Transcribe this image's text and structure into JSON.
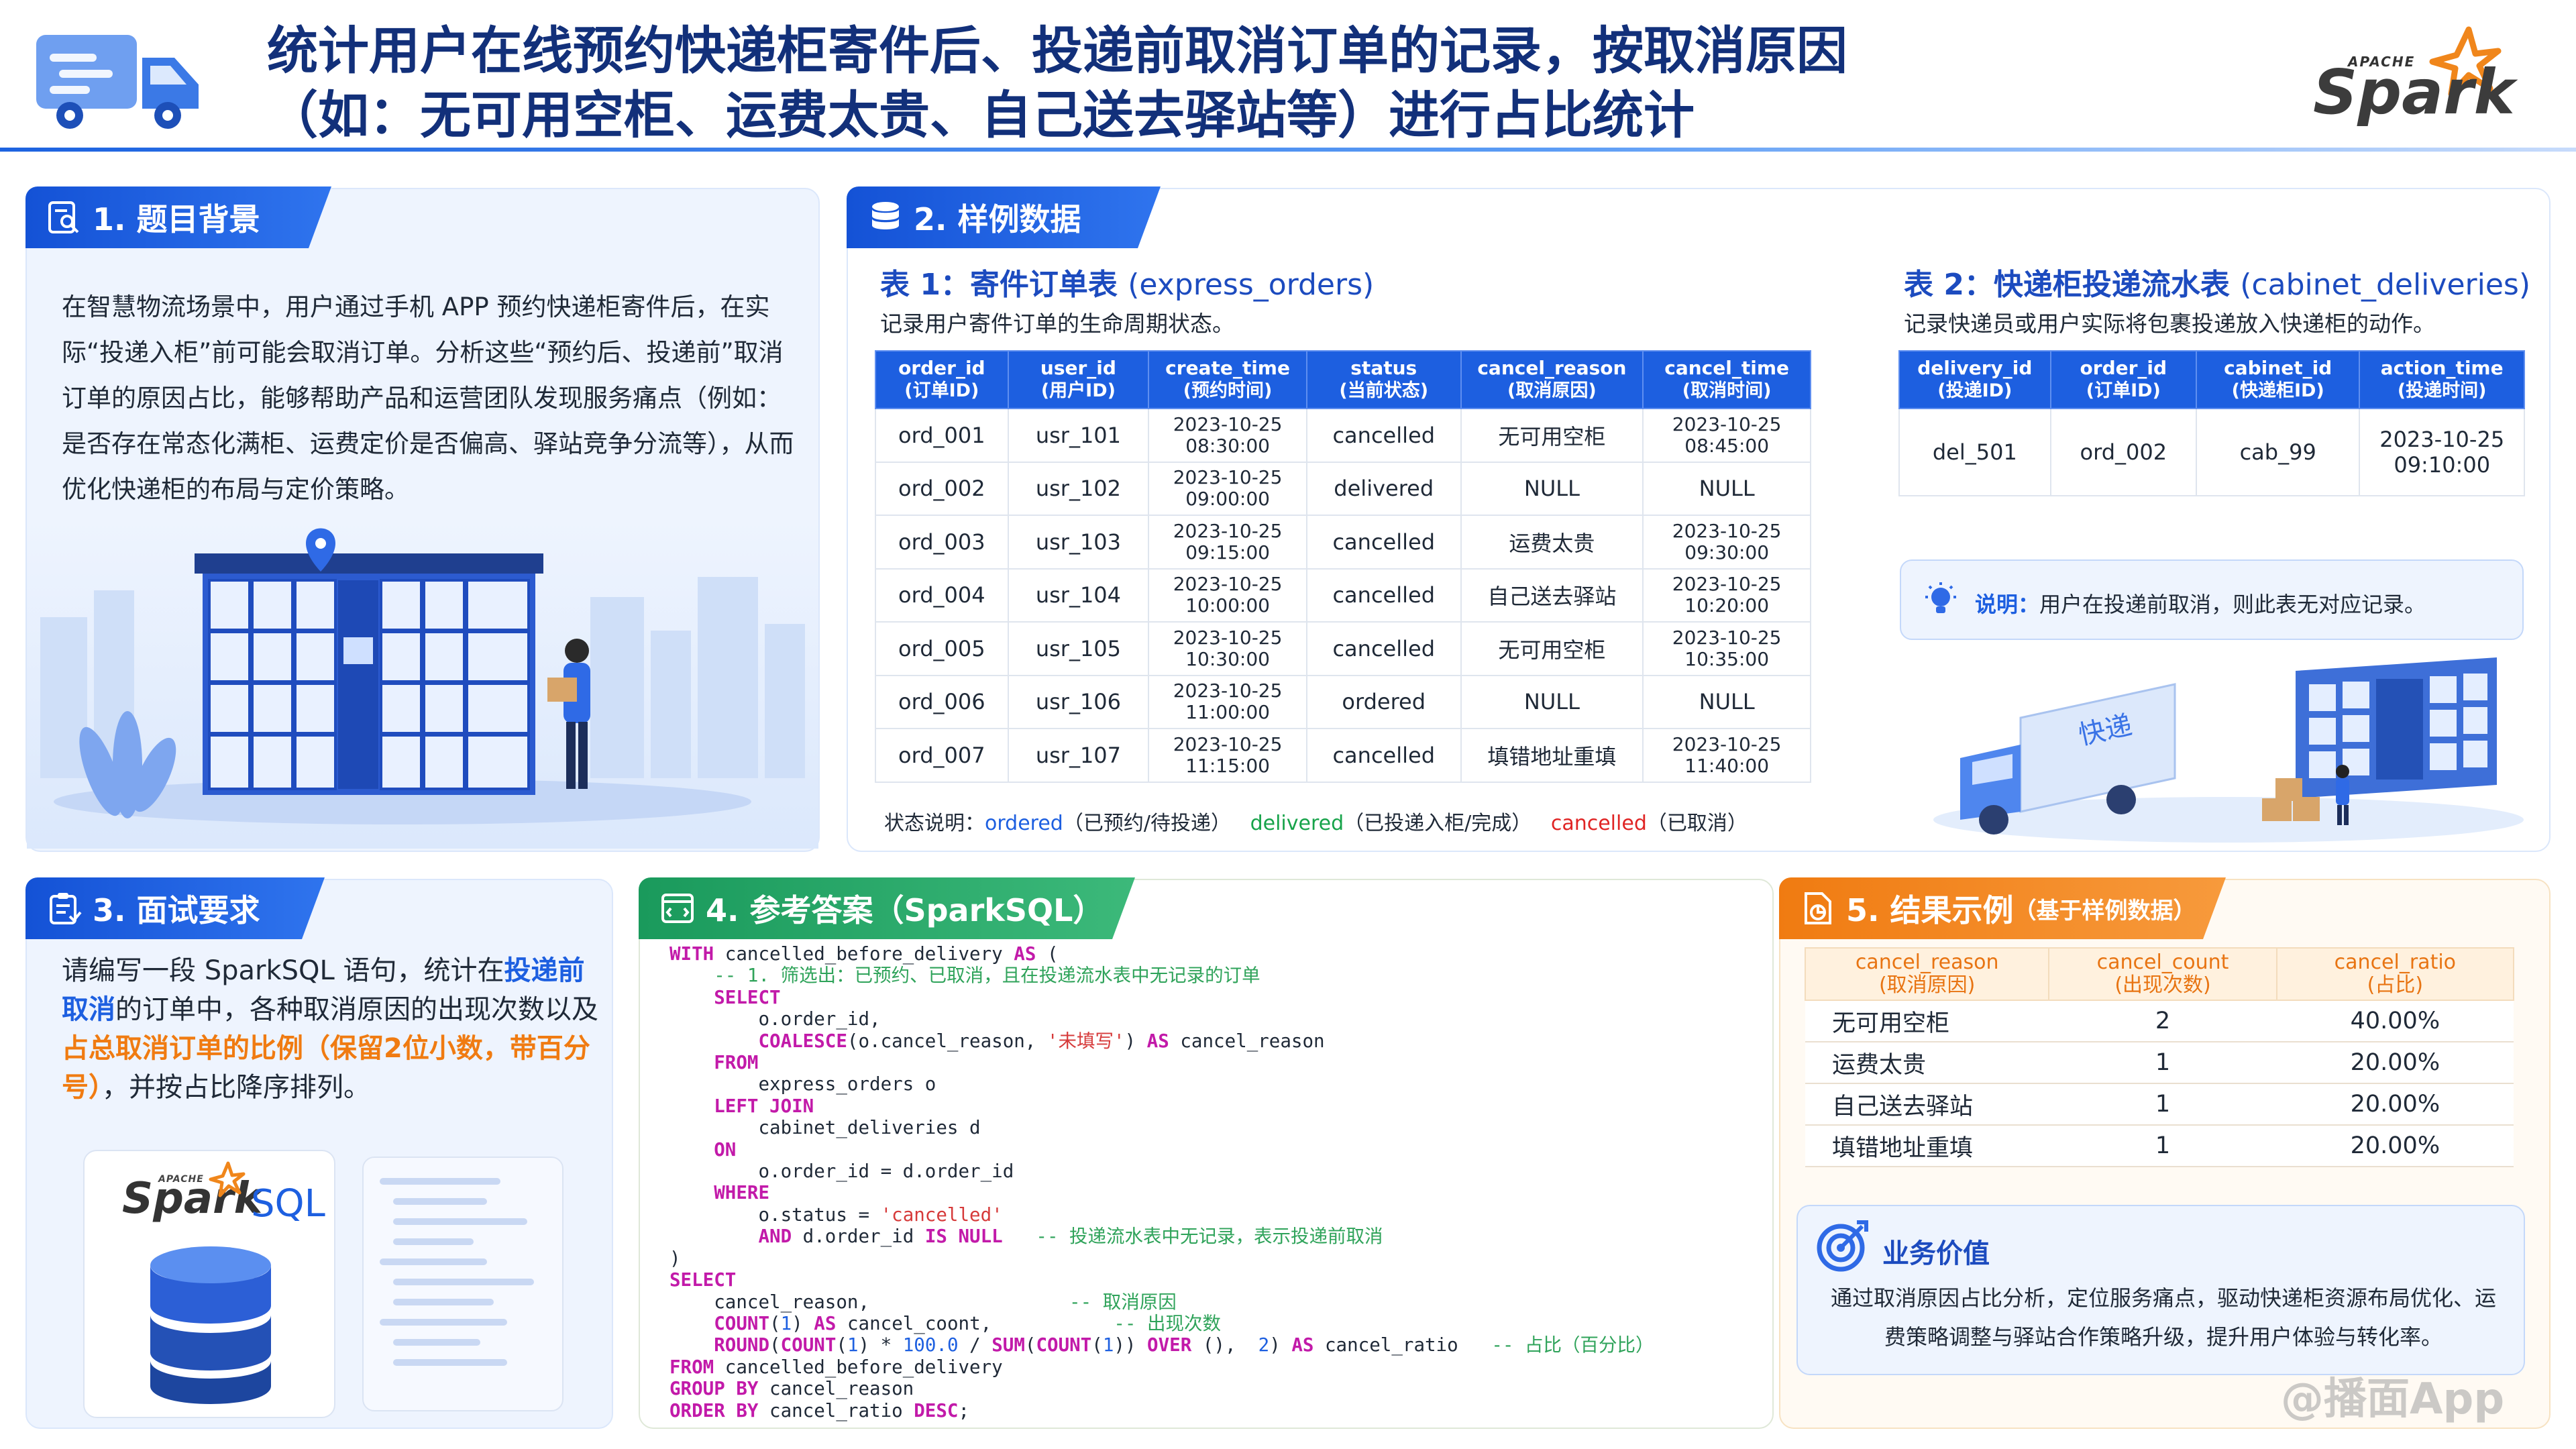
{
  "header": {
    "title_line1": "统计用户在线预约快递柜寄件后、投递前取消订单的记录，按取消原因",
    "title_line2": "（如：无可用空柜、运费太贵、自己送去驿站等）进行占比统计",
    "logo_top": "APACHE",
    "logo_word": "Spark"
  },
  "section1": {
    "title": "1. 题目背景",
    "text": "在智慧物流场景中，用户通过手机 APP 预约快递柜寄件后，在实际“投递入柜”前可能会取消订单。分析这些“预约后、投递前”取消订单的原因占比，能够帮助产品和运营团队发现服务痛点（例如：是否存在常态化满柜、运费定价是否偏高、驿站竞争分流等），从而优化快递柜的布局与定价策略。"
  },
  "section2": {
    "title": "2. 样例数据",
    "table1": {
      "caption": "表 1：寄件订单表",
      "caption_en": "(express_orders)",
      "desc": "记录用户寄件订单的生命周期状态。",
      "headers": [
        {
          "name": "order_id",
          "sub": "(订单ID)"
        },
        {
          "name": "user_id",
          "sub": "(用户ID)"
        },
        {
          "name": "create_time",
          "sub": "(预约时间)"
        },
        {
          "name": "status",
          "sub": "(当前状态)"
        },
        {
          "name": "cancel_reason",
          "sub": "(取消原因)"
        },
        {
          "name": "cancel_time",
          "sub": "(取消时间)"
        }
      ],
      "rows": [
        {
          "order_id": "ord_001",
          "user_id": "usr_101",
          "create_date": "2023-10-25",
          "create_clock": "08:30:00",
          "status": "cancelled",
          "reason": "无可用空柜",
          "cancel_date": "2023-10-25",
          "cancel_clock": "08:45:00"
        },
        {
          "order_id": "ord_002",
          "user_id": "usr_102",
          "create_date": "2023-10-25",
          "create_clock": "09:00:00",
          "status": "delivered",
          "reason": "NULL",
          "cancel_date": "NULL",
          "cancel_clock": ""
        },
        {
          "order_id": "ord_003",
          "user_id": "usr_103",
          "create_date": "2023-10-25",
          "create_clock": "09:15:00",
          "status": "cancelled",
          "reason": "运费太贵",
          "cancel_date": "2023-10-25",
          "cancel_clock": "09:30:00"
        },
        {
          "order_id": "ord_004",
          "user_id": "usr_104",
          "create_date": "2023-10-25",
          "create_clock": "10:00:00",
          "status": "cancelled",
          "reason": "自己送去驿站",
          "cancel_date": "2023-10-25",
          "cancel_clock": "10:20:00"
        },
        {
          "order_id": "ord_005",
          "user_id": "usr_105",
          "create_date": "2023-10-25",
          "create_clock": "10:30:00",
          "status": "cancelled",
          "reason": "无可用空柜",
          "cancel_date": "2023-10-25",
          "cancel_clock": "10:35:00"
        },
        {
          "order_id": "ord_006",
          "user_id": "usr_106",
          "create_date": "2023-10-25",
          "create_clock": "11:00:00",
          "status": "ordered",
          "reason": "NULL",
          "cancel_date": "NULL",
          "cancel_clock": ""
        },
        {
          "order_id": "ord_007",
          "user_id": "usr_107",
          "create_date": "2023-10-25",
          "create_clock": "11:15:00",
          "status": "cancelled",
          "reason": "填错地址重填",
          "cancel_date": "2023-10-25",
          "cancel_clock": "11:40:00"
        }
      ]
    },
    "legend": {
      "label": "状态说明：",
      "ordered": "ordered",
      "ordered_desc": "（已预约/待投递）",
      "delivered": "delivered",
      "delivered_desc": "（已投递入柜/完成）",
      "cancelled": "cancelled",
      "cancelled_desc": "（已取消）"
    },
    "table2": {
      "caption": "表 2：快递柜投递流水表",
      "caption_en": "(cabinet_deliveries)",
      "desc": "记录快递员或用户实际将包裹投递放入快递柜的动作。",
      "headers": [
        {
          "name": "delivery_id",
          "sub": "(投递ID)"
        },
        {
          "name": "order_id",
          "sub": "(订单ID)"
        },
        {
          "name": "cabinet_id",
          "sub": "(快递柜ID)"
        },
        {
          "name": "action_time",
          "sub": "(投递时间)"
        }
      ],
      "rows": [
        {
          "delivery_id": "del_501",
          "order_id": "ord_002",
          "cabinet_id": "cab_99",
          "action_date": "2023-10-25",
          "action_clock": "09:10:00"
        }
      ]
    },
    "note": {
      "label": "说明：",
      "text": "用户在投递前取消，则此表无对应记录。"
    },
    "truck_label": "快递"
  },
  "section3": {
    "title": "3. 面试要求",
    "text_1": "请编写一段 SparkSQL 语句，统计在",
    "text_hl1": "投递前取消",
    "text_2": "的订单中，各种取消原因的出现次数以及",
    "text_hl2": "占总取消订单的比例（保留2位小数，带百分号）",
    "text_3": "，并按占比降序排列。",
    "logo_top": "APACHE",
    "logo_word": "Spark",
    "logo_sql": "SQL"
  },
  "section4": {
    "title": "4. 参考答案（SparkSQL）"
  },
  "section5": {
    "title": "5. 结果示例",
    "title_sub": "（基于样例数据）",
    "headers": [
      {
        "name": "cancel_reason",
        "sub": "(取消原因)"
      },
      {
        "name": "cancel_count",
        "sub": "(出现次数)"
      },
      {
        "name": "cancel_ratio",
        "sub": "(占比)"
      }
    ],
    "rows": [
      {
        "reason": "无可用空柜",
        "count": "2",
        "ratio": "40.00%"
      },
      {
        "reason": "运费太贵",
        "count": "1",
        "ratio": "20.00%"
      },
      {
        "reason": "自己送去驿站",
        "count": "1",
        "ratio": "20.00%"
      },
      {
        "reason": "填错地址重填",
        "count": "1",
        "ratio": "20.00%"
      }
    ],
    "biz_title": "业务价值",
    "biz_text": "通过取消原因占比分析，定位服务痛点，驱动快递柜资源布局优化、运费策略调整与驿站合作策略升级，提升用户体验与转化率。"
  },
  "watermark": "@播面App",
  "colors": {
    "primary_blue": "#1d5fe0",
    "title_navy": "#12307a",
    "green": "#1a9a5c",
    "orange": "#f07b11",
    "cancelled_red": "#e02424",
    "delivered_green": "#17a34a"
  }
}
